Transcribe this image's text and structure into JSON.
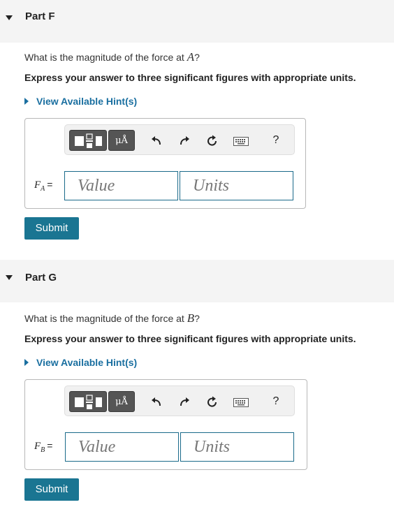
{
  "parts": [
    {
      "title": "Part F",
      "question_prefix": "What is the magnitude of the force at ",
      "question_var": "A",
      "question_suffix": "?",
      "instruction": "Express your answer to three significant figures with appropriate units.",
      "hint_label": "View Available Hint(s)",
      "var_symbol": "F",
      "var_sub": "A",
      "equals": "=",
      "value_placeholder": "Value",
      "units_placeholder": "Units",
      "submit_label": "Submit"
    },
    {
      "title": "Part G",
      "question_prefix": "What is the magnitude of the force at ",
      "question_var": "B",
      "question_suffix": "?",
      "instruction": "Express your answer to three significant figures with appropriate units.",
      "hint_label": "View Available Hint(s)",
      "var_symbol": "F",
      "var_sub": "B",
      "equals": "=",
      "value_placeholder": "Value",
      "units_placeholder": "Units",
      "submit_label": "Submit"
    }
  ],
  "toolbar": {
    "units_button_label": "μÅ",
    "help_label": "?",
    "icons": [
      "fraction-template-icon",
      "undo-icon",
      "redo-icon",
      "reset-icon",
      "keyboard-icon",
      "help-icon"
    ]
  },
  "colors": {
    "header_bg": "#f4f4f4",
    "hint": "#1a6fa0",
    "submit_bg": "#1a7592",
    "field_border": "#1a6a8a",
    "toolbar_button_bg": "#555555"
  }
}
